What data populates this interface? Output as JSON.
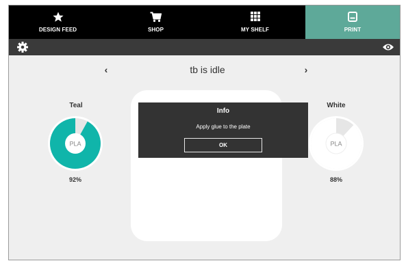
{
  "nav": {
    "items": [
      {
        "label": "DESIGN FEED",
        "icon": "star-icon"
      },
      {
        "label": "SHOP",
        "icon": "cart-icon"
      },
      {
        "label": "MY SHELF",
        "icon": "grid-icon"
      },
      {
        "label": "PRINT",
        "icon": "printer-icon"
      }
    ],
    "active": "PRINT",
    "active_color": "#5ea999"
  },
  "toolbar": {
    "left_icon": "gear-icon",
    "right_icon": "eye-icon"
  },
  "printer": {
    "status": "tb is idle"
  },
  "filaments": [
    {
      "name": "Teal",
      "material": "PLA",
      "percent_text": "92%",
      "percent": 92,
      "color": "#10b5aa"
    },
    {
      "name": "White",
      "material": "PLA",
      "percent_text": "88%",
      "percent": 88,
      "color": "#ffffff"
    }
  ],
  "dialog": {
    "title": "Info",
    "message": "Apply glue to the plate",
    "ok_label": "OK"
  }
}
